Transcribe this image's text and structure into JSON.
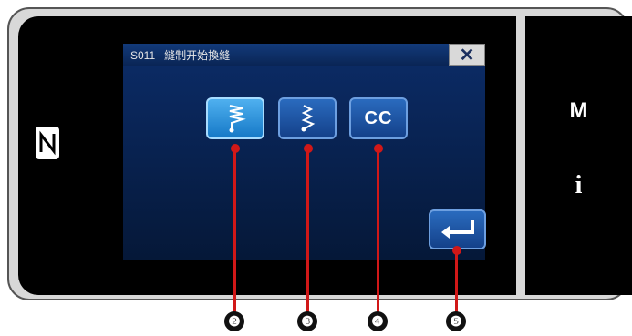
{
  "dialog": {
    "code": "S011",
    "title": "縫制开始換縫",
    "close_label": "✕"
  },
  "buttons": [
    {
      "id": "stitch-type-2",
      "icon": "stitch-pattern-icon",
      "selected": true
    },
    {
      "id": "stitch-type-3",
      "icon": "stitch-pattern-icon",
      "selected": false
    },
    {
      "id": "stitch-cc",
      "label": "CC",
      "selected": false
    }
  ],
  "enter_button": {
    "icon": "enter-return-icon"
  },
  "side_panel": {
    "m_label": "M",
    "info_label": "i"
  },
  "nfc_icon": "nfc-icon",
  "callouts": [
    "❷",
    "❸",
    "❹",
    "❺"
  ],
  "colors": {
    "accent": "#1679c7",
    "title_bar": "#123a7a",
    "callout_line": "#d11818"
  }
}
